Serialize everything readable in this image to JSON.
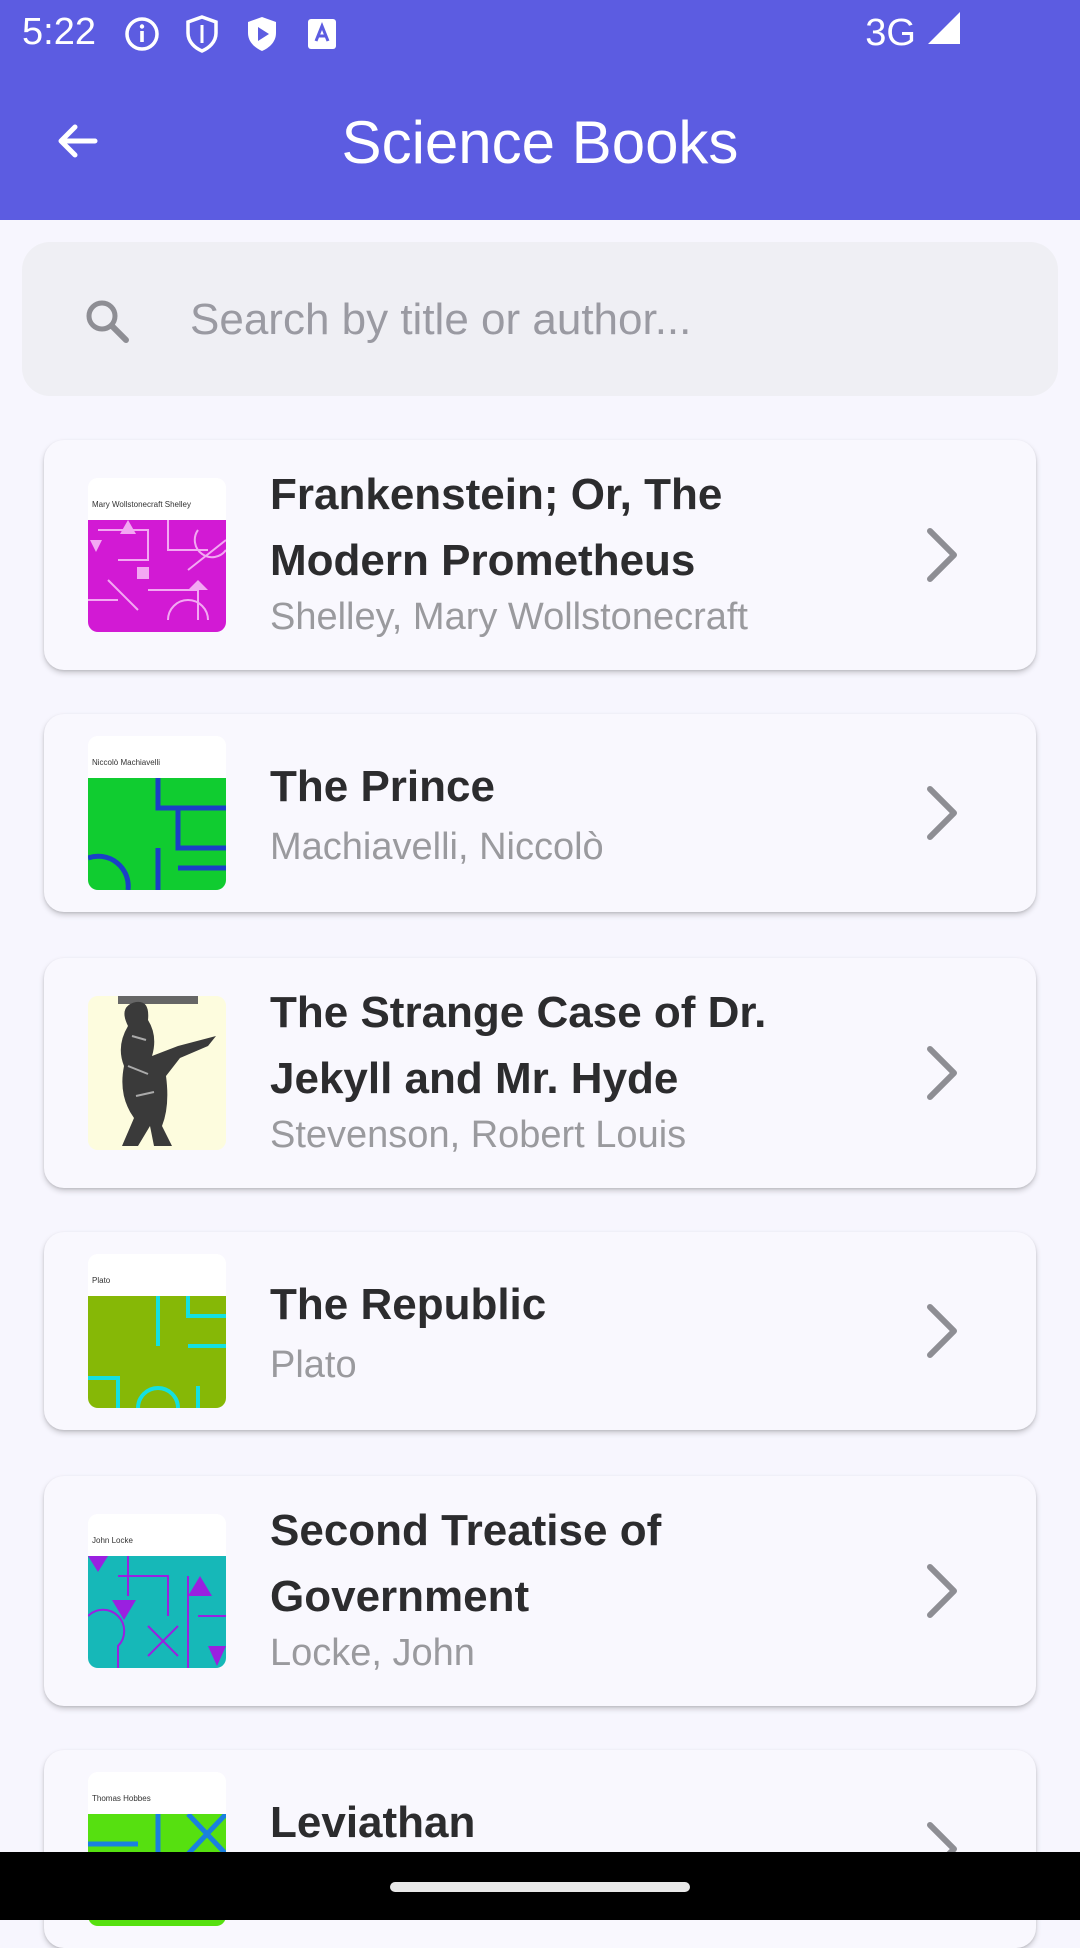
{
  "status_bar": {
    "time": "5:22",
    "network": "3G",
    "icons": [
      "info-icon",
      "shield-icon",
      "play-shield-icon",
      "text-box-icon",
      "signal-icon"
    ]
  },
  "app_bar": {
    "title": "Science Books",
    "back_icon": "arrow-left-icon"
  },
  "search": {
    "placeholder": "Search by title or author...",
    "value": ""
  },
  "books": [
    {
      "title": "Frankenstein; Or, The Modern Prometheus",
      "author": "Shelley, Mary Wollstonecraft",
      "cover_author": "Mary Wollstonecraft Shelley",
      "cover_color": "#d21ad4",
      "cover_pattern_color": "#f0a0f0"
    },
    {
      "title": "The Prince",
      "author": "Machiavelli, Niccolò",
      "cover_author": "Niccolò Machiavelli",
      "cover_color": "#10cc30",
      "cover_pattern_color": "#1a40c8"
    },
    {
      "title": "The Strange Case of Dr. Jekyll and Mr. Hyde",
      "author": "Stevenson, Robert Louis",
      "cover_author": "",
      "cover_color": "#fdfcde",
      "cover_pattern_color": "#444444"
    },
    {
      "title": "The Republic",
      "author": "Plato",
      "cover_author": "Plato",
      "cover_color": "#86b806",
      "cover_pattern_color": "#14e0e0"
    },
    {
      "title": "Second Treatise of Government",
      "author": "Locke, John",
      "cover_author": "John Locke",
      "cover_color": "#16b8b8",
      "cover_pattern_color": "#9a20e0"
    },
    {
      "title": "Leviathan",
      "author": "",
      "cover_author": "Thomas Hobbes",
      "cover_color": "#56e010",
      "cover_pattern_color": "#1a80e0"
    }
  ],
  "colors": {
    "primary": "#5c5ce1",
    "background": "#f7f6fe",
    "title_text": "#2c2c2e",
    "author_text": "#9a9a9e"
  }
}
